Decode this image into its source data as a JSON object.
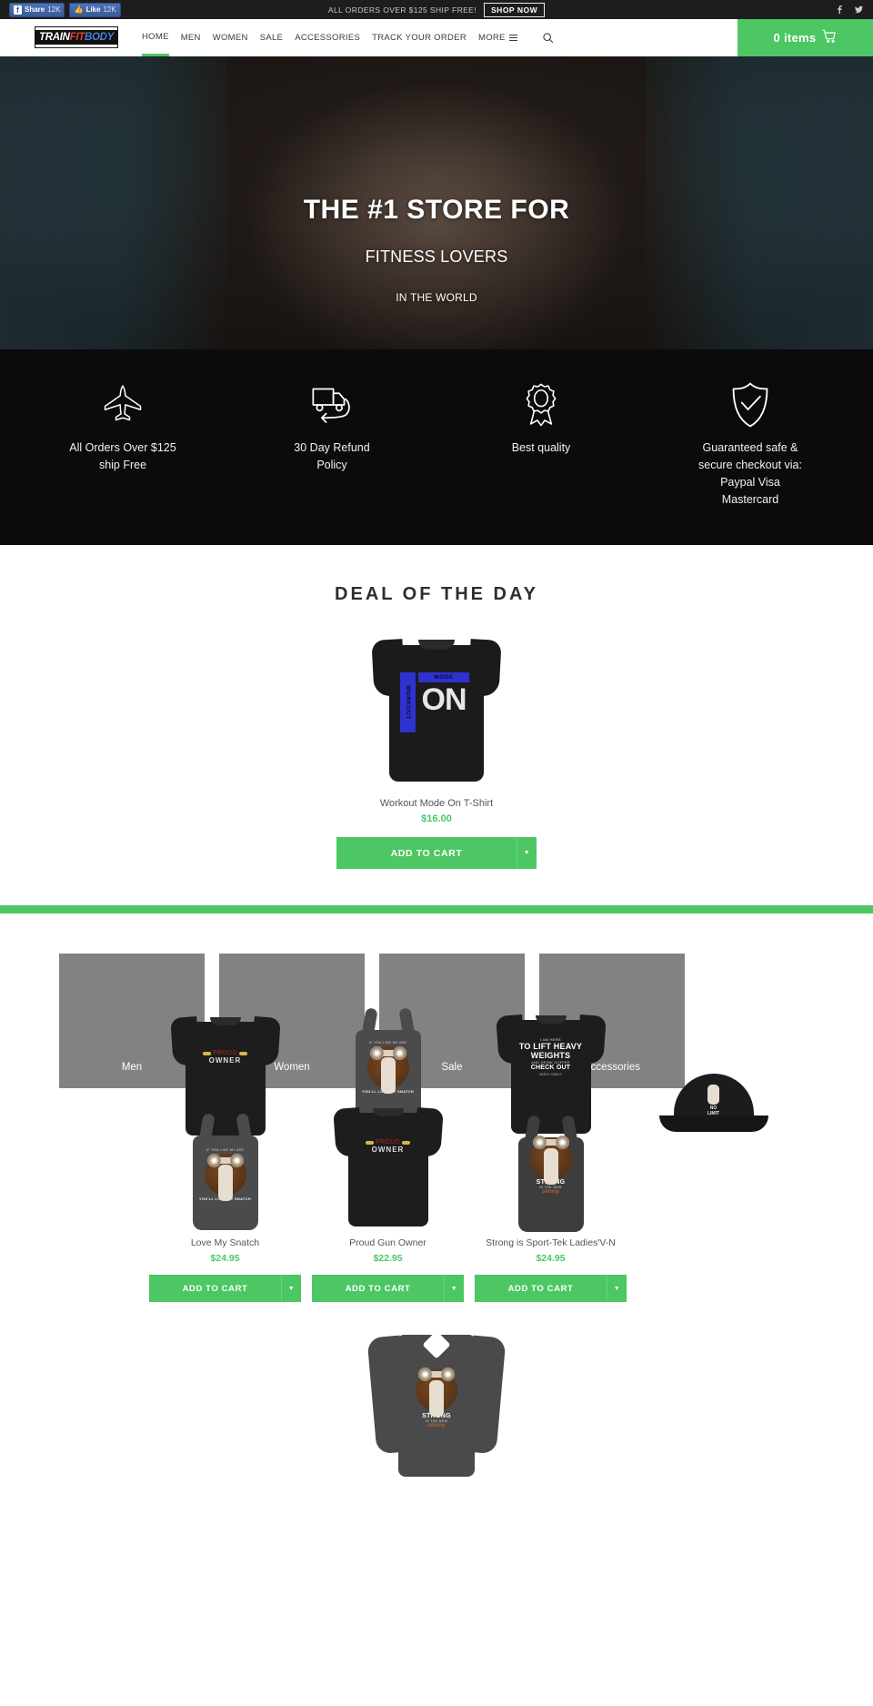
{
  "topbar": {
    "share_label": "Share",
    "share_count": "12K",
    "like_label": "Like",
    "like_count": "12K",
    "promo_text": "ALL ORDERS OVER $125 SHIP FREE!",
    "shop_now_label": "SHOP NOW",
    "facebook_icon": "facebook-icon",
    "twitter_icon": "twitter-icon"
  },
  "nav": {
    "logo": {
      "part1": "TRAIN",
      "part2": "FIT",
      "part3": "BODY"
    },
    "links": [
      {
        "label": "HOME",
        "active": true
      },
      {
        "label": "MEN",
        "active": false
      },
      {
        "label": "WOMEN",
        "active": false
      },
      {
        "label": "SALE",
        "active": false
      },
      {
        "label": "ACCESSORIES",
        "active": false
      },
      {
        "label": "TRACK YOUR ORDER",
        "active": false
      }
    ],
    "more_label": "MORE",
    "search_icon": "search-icon",
    "cart_label": "0 items",
    "cart_icon": "cart-icon",
    "accent_color": "#4cc764"
  },
  "hero": {
    "line1": "THE #1 STORE FOR",
    "line2": "FITNESS LOVERS",
    "line3": "IN THE WORLD"
  },
  "benefits": [
    {
      "icon": "airplane-icon",
      "text": "All Orders Over $125 ship Free"
    },
    {
      "icon": "truck-return-icon",
      "text": "30 Day Refund Policy"
    },
    {
      "icon": "award-ribbon-icon",
      "text": "Best quality"
    },
    {
      "icon": "shield-check-icon",
      "text": "Guaranteed safe & secure checkout via: Paypal Visa Mastercard"
    }
  ],
  "deal": {
    "title": "DEAL OF THE DAY",
    "product": {
      "name": "Workout Mode On T-Shirt",
      "price": "$16.00",
      "art": {
        "vertical": "WORKOUT",
        "mode": "MODE",
        "on": "ON"
      },
      "add_to_cart": "ADD TO CART"
    }
  },
  "collections": [
    {
      "label": "Men"
    },
    {
      "label": "Women"
    },
    {
      "label": "Sale"
    },
    {
      "label": "Accessories"
    }
  ],
  "products": [
    {
      "name": "Love My Snatch",
      "price": "$24.95",
      "add_to_cart": "ADD TO CART",
      "art_top": "IF YOU LIKE MY ASS",
      "art_bottom": "YOU'LL LOVE MY SNATCH"
    },
    {
      "name": "Proud Gun Owner",
      "price": "$22.95",
      "add_to_cart": "ADD TO CART",
      "art_top": "PROUD",
      "art_bottom": "OWNER"
    },
    {
      "name": "Strong is Sport-Tek Ladies'V-N",
      "price": "$24.95",
      "add_to_cart": "ADD TO CART",
      "art_top": "STRONG",
      "art_mid": "IS THE NEW",
      "art_bottom": "skinny"
    }
  ],
  "lift_art": {
    "l1": "I AM HERE",
    "l2": "TO LIFT HEAVY WEIGHTS",
    "l3": "AND DRINK COFFEE",
    "l4": "CHECK OUT",
    "l5": "BODY GIRLS"
  },
  "cap_art": {
    "l1": "NO",
    "l2": "LIMIT"
  },
  "bottom_product": {
    "art_l1": "STRONG",
    "art_l2": "IS THE NEW",
    "art_l3": "skinny"
  }
}
